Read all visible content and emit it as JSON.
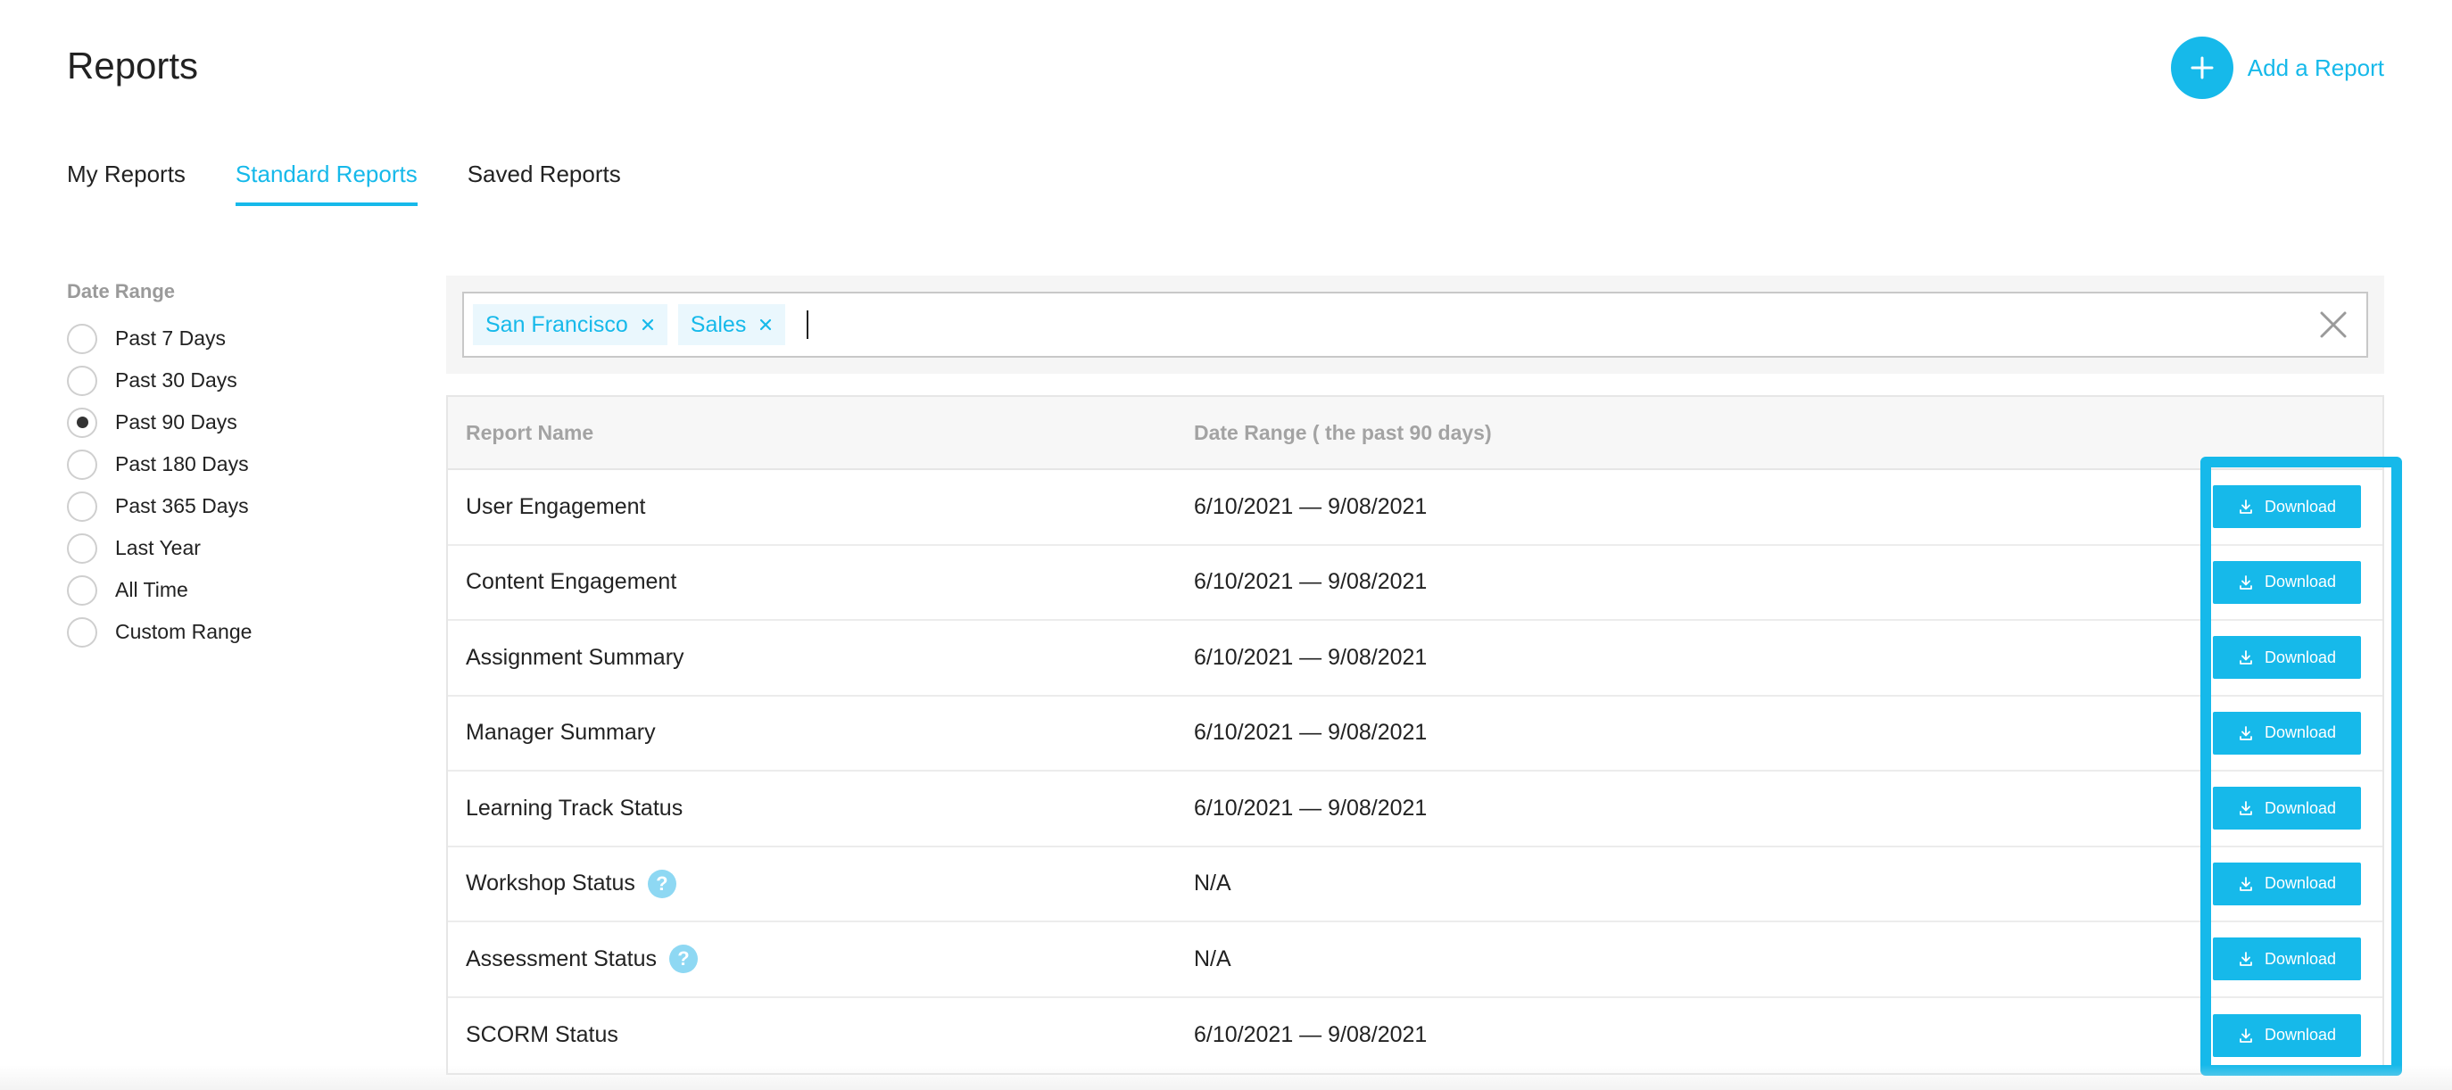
{
  "page": {
    "title": "Reports"
  },
  "header": {
    "add_report_label": "Add a Report"
  },
  "tabs": [
    {
      "label": "My Reports",
      "active": false
    },
    {
      "label": "Standard Reports",
      "active": true
    },
    {
      "label": "Saved Reports",
      "active": false
    }
  ],
  "filters": {
    "title": "Date Range",
    "options": [
      {
        "label": "Past 7 Days",
        "checked": false
      },
      {
        "label": "Past 30 Days",
        "checked": false
      },
      {
        "label": "Past 90 Days",
        "checked": true
      },
      {
        "label": "Past 180 Days",
        "checked": false
      },
      {
        "label": "Past 365 Days",
        "checked": false
      },
      {
        "label": "Last Year",
        "checked": false
      },
      {
        "label": "All Time",
        "checked": false
      },
      {
        "label": "Custom Range",
        "checked": false
      }
    ]
  },
  "search": {
    "chips": [
      {
        "label": "San Francisco"
      },
      {
        "label": "Sales"
      }
    ],
    "value": "",
    "placeholder": ""
  },
  "table": {
    "headers": {
      "name": "Report Name",
      "range": "Date Range ( the past 90 days)"
    },
    "download_label": "Download",
    "rows": [
      {
        "name": "User Engagement",
        "range": "6/10/2021 — 9/08/2021",
        "help": false
      },
      {
        "name": "Content Engagement",
        "range": "6/10/2021 — 9/08/2021",
        "help": false
      },
      {
        "name": "Assignment Summary",
        "range": "6/10/2021 — 9/08/2021",
        "help": false
      },
      {
        "name": "Manager Summary",
        "range": "6/10/2021 — 9/08/2021",
        "help": false
      },
      {
        "name": "Learning Track Status",
        "range": "6/10/2021 — 9/08/2021",
        "help": false
      },
      {
        "name": "Workshop Status",
        "range": "N/A",
        "help": true
      },
      {
        "name": "Assessment Status",
        "range": "N/A",
        "help": true
      },
      {
        "name": "SCORM Status",
        "range": "6/10/2021 — 9/08/2021",
        "help": false
      }
    ]
  },
  "colors": {
    "accent": "#16b9ea",
    "help_icon": "#8ed8f3",
    "muted_text": "#a3a3a3"
  }
}
